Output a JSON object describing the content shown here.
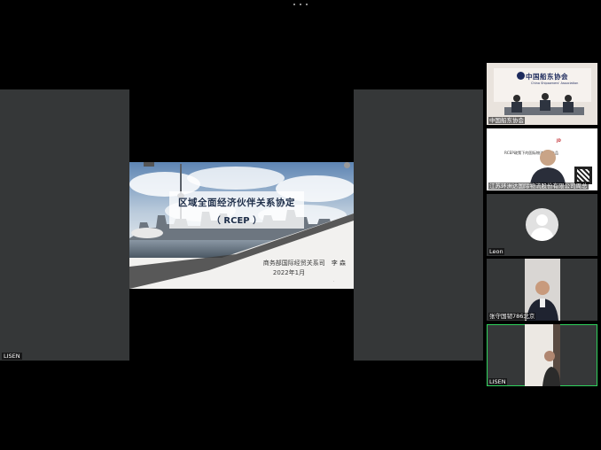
{
  "main_stage": {
    "speaker_label": "LISEN",
    "slide": {
      "title": "区域全面经济伙伴关系协定",
      "subtitle": "（ RCEP ）",
      "author": "商务部国际经贸关系司　李 森",
      "date": "2022年1月"
    }
  },
  "participants": [
    {
      "name": "中国船东协会",
      "banner_text": "中国船东协会",
      "banner_sub": "China Shipowners' Association"
    },
    {
      "name": "江苏环洲达国际物流股份有限公司周总",
      "title": "RCEP政策下的国际物流服务产品"
    },
    {
      "name": "Leon"
    },
    {
      "name": "张守国韧786北京"
    },
    {
      "name": "LISEN"
    }
  ],
  "colors": {
    "active_speaker_border": "#2fd15c",
    "stage_background": "#353738"
  }
}
